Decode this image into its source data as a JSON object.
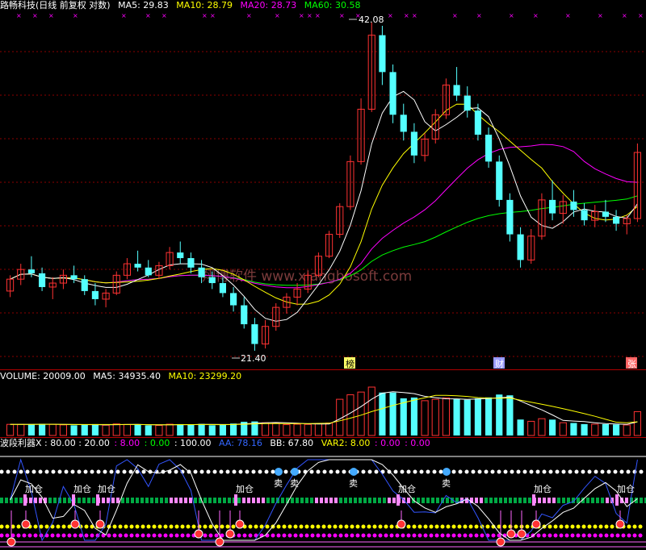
{
  "price": {
    "title": "路畅科技(日线 前复权 对数)",
    "ma5": "MA5: 29.83",
    "ma10": "MA10: 28.79",
    "ma20": "MA20: 28.73",
    "ma60": "MA60: 30.58",
    "high_label": "42.08",
    "low_label": "21.40",
    "watermark": "翔博软件 www.xiangbosoft.com",
    "event_bang": "榜",
    "event_cai": "财",
    "event_zhang": "张"
  },
  "volume": {
    "title": "VOLUME: 20009.00",
    "ma5": "MA5: 34935.40",
    "ma10": "MA10: 23299.20"
  },
  "indicator": {
    "title": "波段利器X : 80.00 : 20.00",
    "v1": ": 8.00",
    "v2": ": 0.00",
    "v3": ": 100.00",
    "aa": "AA: 78.16",
    "bb": "BB: 67.80",
    "var2": "VAR2: 8.00",
    "v4": ": 0.00",
    "v5": ": 0.00",
    "add_label": "加仓",
    "sell_label": "卖"
  },
  "colors": {
    "up": "#ff3232",
    "down": "#54ffff",
    "ma5": "#ffffff",
    "ma10": "#ffff00",
    "ma20": "#ff00ff",
    "ma60": "#00ff00",
    "grid": "#8b0000"
  },
  "chart_data": {
    "type": "candlestick",
    "price_high": 42.08,
    "price_low": 21.4,
    "y_scale": "log",
    "candles": [
      [
        24.2,
        25.0,
        23.9,
        24.8
      ],
      [
        24.8,
        25.6,
        24.5,
        25.3
      ],
      [
        25.3,
        26.0,
        24.9,
        25.1
      ],
      [
        25.1,
        25.4,
        24.2,
        24.4
      ],
      [
        24.4,
        24.9,
        23.8,
        24.6
      ],
      [
        24.6,
        25.3,
        24.3,
        25.0
      ],
      [
        25.0,
        25.5,
        24.6,
        24.8
      ],
      [
        24.8,
        25.0,
        24.0,
        24.2
      ],
      [
        24.2,
        24.6,
        23.5,
        23.8
      ],
      [
        23.8,
        24.3,
        23.4,
        24.1
      ],
      [
        24.1,
        25.2,
        24.0,
        25.0
      ],
      [
        25.0,
        25.9,
        24.8,
        25.6
      ],
      [
        25.6,
        26.3,
        25.2,
        25.4
      ],
      [
        25.4,
        25.8,
        24.9,
        25.0
      ],
      [
        25.0,
        25.7,
        24.8,
        25.5
      ],
      [
        25.5,
        26.5,
        25.3,
        26.2
      ],
      [
        26.2,
        26.8,
        25.6,
        25.9
      ],
      [
        25.9,
        26.2,
        25.1,
        25.4
      ],
      [
        25.4,
        25.8,
        24.6,
        24.9
      ],
      [
        24.9,
        25.2,
        24.3,
        24.6
      ],
      [
        24.6,
        24.9,
        23.9,
        24.1
      ],
      [
        24.1,
        24.4,
        23.2,
        23.5
      ],
      [
        23.5,
        23.9,
        22.4,
        22.6
      ],
      [
        22.6,
        22.9,
        21.4,
        21.7
      ],
      [
        21.7,
        22.8,
        21.5,
        22.5
      ],
      [
        22.5,
        23.6,
        22.3,
        23.4
      ],
      [
        23.4,
        24.1,
        23.1,
        23.9
      ],
      [
        23.9,
        24.6,
        23.5,
        24.3
      ],
      [
        24.3,
        25.2,
        24.1,
        25.0
      ],
      [
        25.0,
        26.2,
        24.9,
        26.0
      ],
      [
        26.0,
        27.4,
        25.9,
        27.2
      ],
      [
        27.2,
        29.0,
        27.0,
        28.8
      ],
      [
        28.8,
        32.0,
        28.6,
        31.6
      ],
      [
        31.6,
        36.0,
        31.4,
        35.2
      ],
      [
        35.2,
        42.08,
        35.0,
        41.0
      ],
      [
        41.0,
        41.8,
        37.0,
        38.0
      ],
      [
        38.0,
        38.6,
        34.2,
        34.8
      ],
      [
        34.8,
        35.6,
        33.0,
        33.6
      ],
      [
        33.6,
        34.2,
        31.5,
        32.0
      ],
      [
        32.0,
        33.5,
        31.6,
        33.1
      ],
      [
        33.1,
        35.2,
        32.8,
        34.8
      ],
      [
        34.8,
        37.5,
        34.5,
        37.0
      ],
      [
        37.0,
        38.4,
        35.8,
        36.2
      ],
      [
        36.2,
        36.9,
        34.6,
        35.1
      ],
      [
        35.1,
        35.6,
        33.0,
        33.4
      ],
      [
        33.4,
        33.9,
        31.2,
        31.6
      ],
      [
        31.6,
        32.0,
        28.8,
        29.2
      ],
      [
        29.2,
        29.6,
        26.8,
        27.2
      ],
      [
        27.2,
        27.6,
        25.4,
        25.8
      ],
      [
        25.8,
        27.5,
        25.6,
        27.1
      ],
      [
        27.1,
        29.6,
        26.9,
        29.2
      ],
      [
        29.2,
        30.4,
        28.0,
        28.4
      ],
      [
        28.4,
        29.5,
        27.8,
        29.1
      ],
      [
        29.1,
        29.8,
        28.2,
        28.6
      ],
      [
        28.6,
        29.0,
        27.7,
        28.0
      ],
      [
        28.0,
        28.9,
        27.6,
        28.5
      ],
      [
        28.5,
        29.2,
        27.9,
        28.2
      ],
      [
        28.2,
        28.6,
        27.4,
        27.8
      ],
      [
        27.8,
        28.3,
        27.2,
        28.1
      ],
      [
        28.1,
        32.8,
        27.9,
        32.2
      ]
    ]
  }
}
